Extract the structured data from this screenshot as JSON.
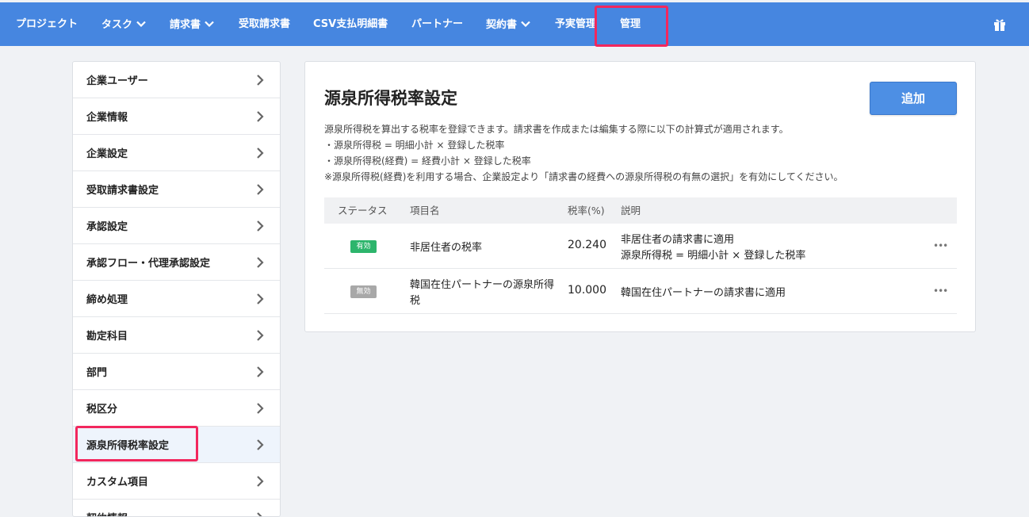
{
  "nav": {
    "items": [
      {
        "label": "プロジェクト",
        "dropdown": false
      },
      {
        "label": "タスク",
        "dropdown": true
      },
      {
        "label": "請求書",
        "dropdown": true
      },
      {
        "label": "受取請求書",
        "dropdown": false
      },
      {
        "label": "CSV支払明細書",
        "dropdown": false
      },
      {
        "label": "パートナー",
        "dropdown": false
      },
      {
        "label": "契約書",
        "dropdown": true
      },
      {
        "label": "予実管理",
        "dropdown": false
      },
      {
        "label": "管理",
        "dropdown": false,
        "highlighted": true
      }
    ],
    "right_icon": "gift-icon",
    "background": "#4686e0"
  },
  "sidebar": {
    "items": [
      {
        "label": "企業ユーザー"
      },
      {
        "label": "企業情報"
      },
      {
        "label": "企業設定"
      },
      {
        "label": "受取請求書設定"
      },
      {
        "label": "承認設定"
      },
      {
        "label": "承認フロー・代理承認設定"
      },
      {
        "label": "締め処理"
      },
      {
        "label": "勘定科目"
      },
      {
        "label": "部門"
      },
      {
        "label": "税区分"
      },
      {
        "label": "源泉所得税率設定",
        "active": true
      },
      {
        "label": "カスタム項目"
      },
      {
        "label": "契約情報"
      }
    ]
  },
  "main": {
    "title": "源泉所得税率設定",
    "add_button": "追加",
    "description": [
      "源泉所得税を算出する税率を登録できます。請求書を作成または編集する際に以下の計算式が適用されます。",
      "・源泉所得税 = 明細小計 × 登録した税率",
      "・源泉所得税(経費) = 経費小計 × 登録した税率",
      "※源泉所得税(経費)を利用する場合、企業設定より「請求書の経費への源泉所得税の有無の選択」を有効にしてください。"
    ],
    "table": {
      "headers": [
        "ステータス",
        "項目名",
        "税率(%)",
        "説明"
      ],
      "rows": [
        {
          "status": "有効",
          "active": true,
          "name": [
            "非居住者の税率"
          ],
          "rate": "20.240",
          "desc": [
            "非居住者の請求書に適用",
            "源泉所得税 = 明細小計 × 登録した税率"
          ]
        },
        {
          "status": "無効",
          "active": false,
          "name": [
            "韓国在住パートナーの源泉所得",
            "税"
          ],
          "rate": "10.000",
          "desc": [
            "韓国在住パートナーの請求書に適用"
          ]
        }
      ]
    }
  },
  "colors": {
    "accent": "#4686e0",
    "highlight": "#f2275d",
    "badge_on": "#2db56c",
    "badge_off": "#a8a8a8"
  }
}
